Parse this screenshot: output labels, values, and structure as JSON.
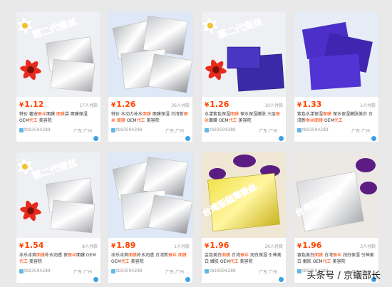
{
  "products": [
    {
      "price": "1.12",
      "buyers": "17人付款",
      "title_parts": [
        {
          "t": "特价 奢宠",
          "h": false
        },
        {
          "t": "蚕丝",
          "h": true
        },
        {
          "t": "面膜 ",
          "h": false
        },
        {
          "t": "面膜",
          "h": true
        },
        {
          "t": "袋 面膜保湿 OEM",
          "h": false
        },
        {
          "t": "代工",
          "h": true
        },
        {
          "t": " 美容院",
          "h": false
        }
      ],
      "shop": "tb93594289",
      "location": "广东 广州",
      "overlay": "第二代蚕丝",
      "image": "flower-foil"
    },
    {
      "price": "1.26",
      "buyers": "36人付款",
      "title_parts": [
        {
          "t": "特价 水动力补水",
          "h": false
        },
        {
          "t": "面膜",
          "h": true
        },
        {
          "t": " 面膜保湿 台湾新",
          "h": false
        },
        {
          "t": "蚕丝",
          "h": true
        },
        {
          "t": " ",
          "h": false
        },
        {
          "t": "面膜",
          "h": true
        },
        {
          "t": " OEM",
          "h": false
        },
        {
          "t": "代工",
          "h": true
        },
        {
          "t": " 美容院",
          "h": false
        }
      ],
      "shop": "tb93594289",
      "location": "广东 广州",
      "overlay": "",
      "image": "silver-foil"
    },
    {
      "price": "1.26",
      "buyers": "10人付款",
      "title_parts": [
        {
          "t": "水漾紫色保湿",
          "h": false
        },
        {
          "t": "面膜",
          "h": true
        },
        {
          "t": " 保水保湿嫩肤 三层",
          "h": false
        },
        {
          "t": "蚕丝",
          "h": true
        },
        {
          "t": "面膜 OEM",
          "h": false
        },
        {
          "t": "代工",
          "h": true
        },
        {
          "t": " 美容院",
          "h": false
        }
      ],
      "shop": "tb93594289",
      "location": "广东 广州",
      "overlay": "第二代蚕丝",
      "image": "flower-purple"
    },
    {
      "price": "1.33",
      "buyers": "1人付款",
      "title_parts": [
        {
          "t": "紫色水漾保湿",
          "h": false
        },
        {
          "t": "面膜",
          "h": true
        },
        {
          "t": " 保水保湿嫩肤美白 台湾新",
          "h": false
        },
        {
          "t": "蚕丝",
          "h": true
        },
        {
          "t": "面膜",
          "h": true
        },
        {
          "t": " OEM",
          "h": false
        },
        {
          "t": "代工",
          "h": true
        }
      ],
      "shop": "tb93594289",
      "location": "广东 广州",
      "overlay": "",
      "image": "purple-foil"
    },
    {
      "price": "1.54",
      "buyers": "8人付款",
      "title_parts": [
        {
          "t": "冰乐冰爽",
          "h": false
        },
        {
          "t": "面膜",
          "h": true
        },
        {
          "t": "补水润透 保",
          "h": false
        },
        {
          "t": "蚕丝",
          "h": true
        },
        {
          "t": "面膜 OEM",
          "h": false
        },
        {
          "t": "代工",
          "h": true
        },
        {
          "t": " 美容院",
          "h": false
        }
      ],
      "shop": "tb93594289",
      "location": "广东 广州",
      "overlay": "第二代蚕丝",
      "image": "flower-foil"
    },
    {
      "price": "1.89",
      "buyers": "1人付款",
      "title_parts": [
        {
          "t": "冰乐冰爽",
          "h": false
        },
        {
          "t": "面膜",
          "h": true
        },
        {
          "t": "补水润透 台湾新",
          "h": false
        },
        {
          "t": "蚕丝",
          "h": true
        },
        {
          "t": " ",
          "h": false
        },
        {
          "t": "面膜",
          "h": true
        },
        {
          "t": " OEM",
          "h": false
        },
        {
          "t": "代工",
          "h": true
        },
        {
          "t": " 美容院",
          "h": false
        }
      ],
      "shop": "tb93594289",
      "location": "广东 广州",
      "overlay": "",
      "image": "silver-foil"
    },
    {
      "price": "1.96",
      "buyers": "26人付款",
      "title_parts": [
        {
          "t": "金色美白",
          "h": false
        },
        {
          "t": "面膜",
          "h": true
        },
        {
          "t": " 台湾",
          "h": false
        },
        {
          "t": "蚕丝",
          "h": true
        },
        {
          "t": " 润白保湿 引神美白 嫩肤 OEM",
          "h": false
        },
        {
          "t": "代工",
          "h": true
        },
        {
          "t": " 美容院",
          "h": false
        }
      ],
      "shop": "tb93594289",
      "location": "广东 广州",
      "overlay": "台湾版超薄蚕丝",
      "image": "gold-foil"
    },
    {
      "price": "1.96",
      "buyers": "3人付款",
      "title_parts": [
        {
          "t": "银色美白",
          "h": false
        },
        {
          "t": "面膜",
          "h": true
        },
        {
          "t": " 台湾",
          "h": false
        },
        {
          "t": "蚕丝",
          "h": true
        },
        {
          "t": " 润白保湿 引神美白 嫩肤 OEM",
          "h": false
        },
        {
          "t": "代工",
          "h": true
        },
        {
          "t": " 美容院",
          "h": false
        }
      ],
      "shop": "tb93594289",
      "location": "广东 广州",
      "overlay": "台湾版超薄蚕",
      "image": "silver-purple"
    }
  ],
  "currency_symbol": "¥",
  "watermark": "头条号 / 京蟻部长",
  "colors": {
    "price": "#ff4400",
    "highlight": "#ff4400",
    "shop_icon": "#5fb8e6",
    "dot": "#3aa0e6"
  }
}
